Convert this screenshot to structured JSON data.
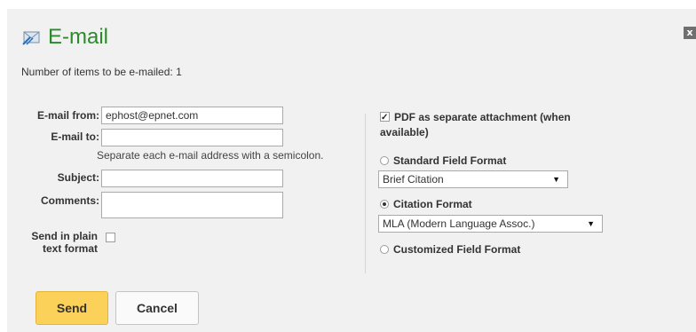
{
  "dialog": {
    "title": "E-mail",
    "close_glyph": "x",
    "count_text": "Number of items to be e-mailed: 1"
  },
  "form": {
    "from_label": "E-mail from:",
    "from_value": "ephost@epnet.com",
    "to_label": "E-mail to:",
    "to_value": "",
    "to_hint": "Separate each e-mail address with a semicolon.",
    "subject_label": "Subject:",
    "subject_value": "",
    "comments_label": "Comments:",
    "comments_value": "",
    "plain_label_line1": "Send in plain",
    "plain_label_line2": "text format",
    "plain_checked": false
  },
  "options": {
    "pdf_label_line1": "PDF as separate attachment (when",
    "pdf_label_line2": "available)",
    "pdf_checked": true,
    "standard_label": "Standard Field Format",
    "standard_selected": false,
    "standard_value": "Brief Citation",
    "citation_label": "Citation Format",
    "citation_selected": true,
    "citation_value": "MLA (Modern Language Assoc.)",
    "customized_label": "Customized Field Format",
    "customized_selected": false
  },
  "buttons": {
    "send": "Send",
    "cancel": "Cancel"
  },
  "colors": {
    "title": "#2b8a2b",
    "panel": "#f1f1f1",
    "send_button": "#fcd15a"
  },
  "icons": {
    "title_icon": "envelope-icon",
    "close_icon": "close-icon",
    "dropdown_arrow": "chevron-down-icon"
  }
}
